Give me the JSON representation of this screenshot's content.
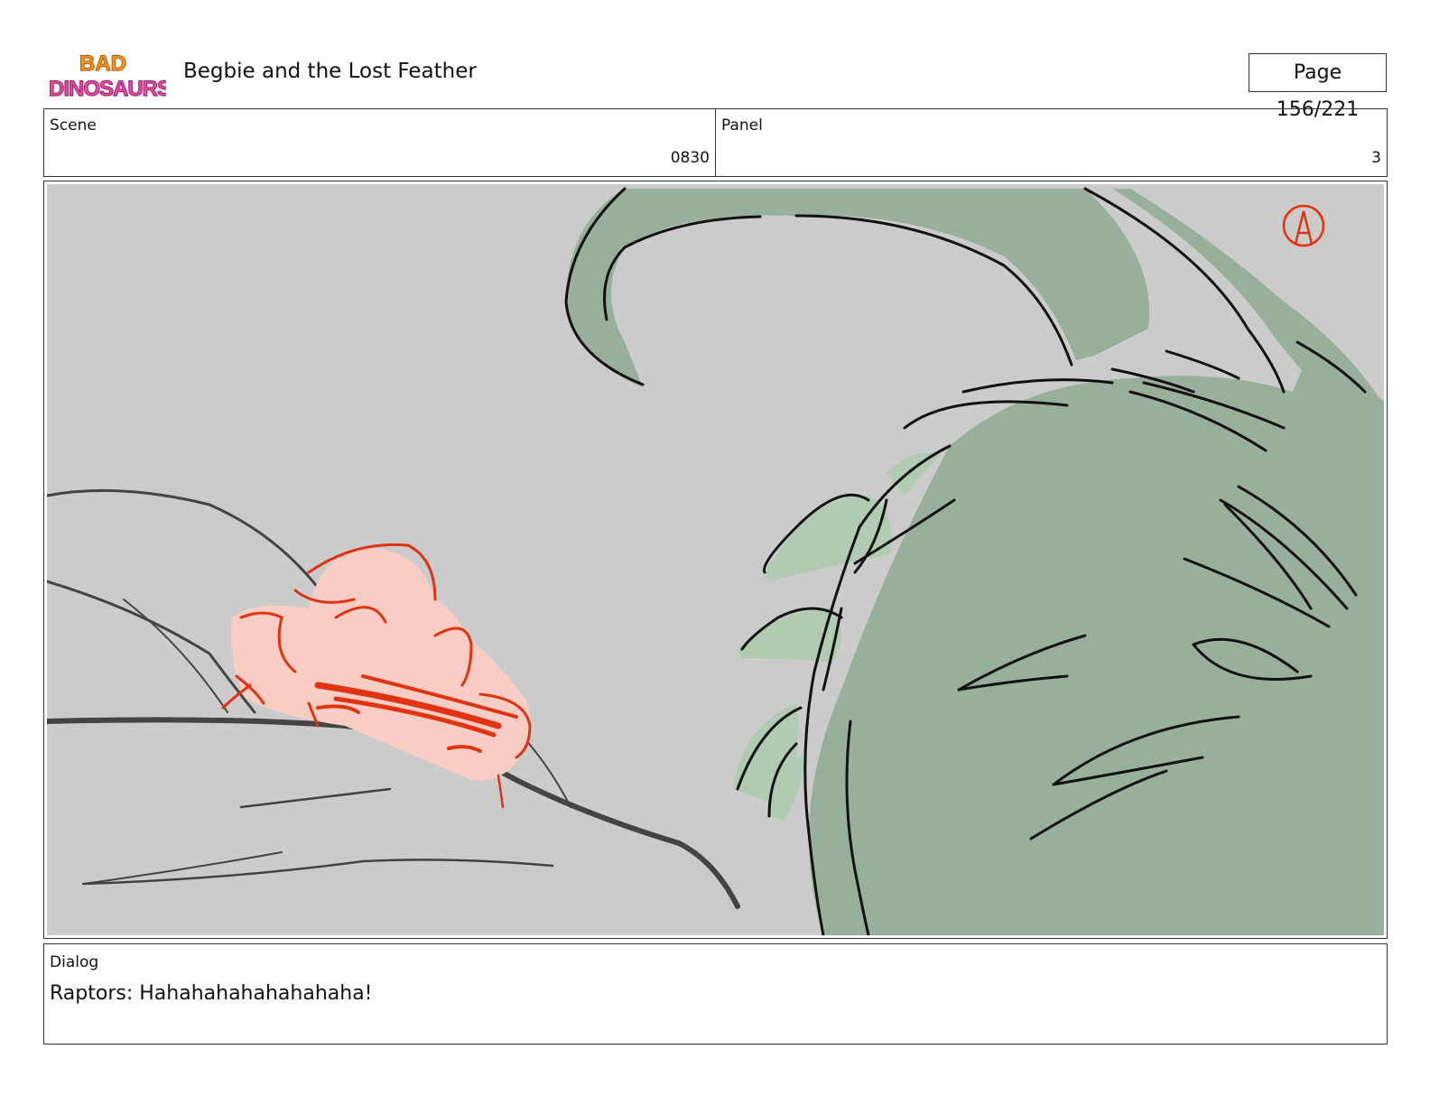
{
  "header": {
    "logo_text": "BAD DINOSAURS",
    "title": "Begbie and the Lost Feather",
    "page_label": "Page 156/221"
  },
  "info": {
    "scene_label": "Scene",
    "scene_value": "0830",
    "panel_label": "Panel",
    "panel_value": "3"
  },
  "panel": {
    "mark": "A",
    "colors": {
      "background": "#cbcbcb",
      "dinosaur_green": "#98b09b",
      "leaf_green": "#b1cbb2",
      "character_pink": "#f9cdc4",
      "sketch_red": "#e03312",
      "ink": "#111111"
    }
  },
  "dialog": {
    "label": "Dialog",
    "text": "Raptors: Hahahahahahahahaha!"
  }
}
